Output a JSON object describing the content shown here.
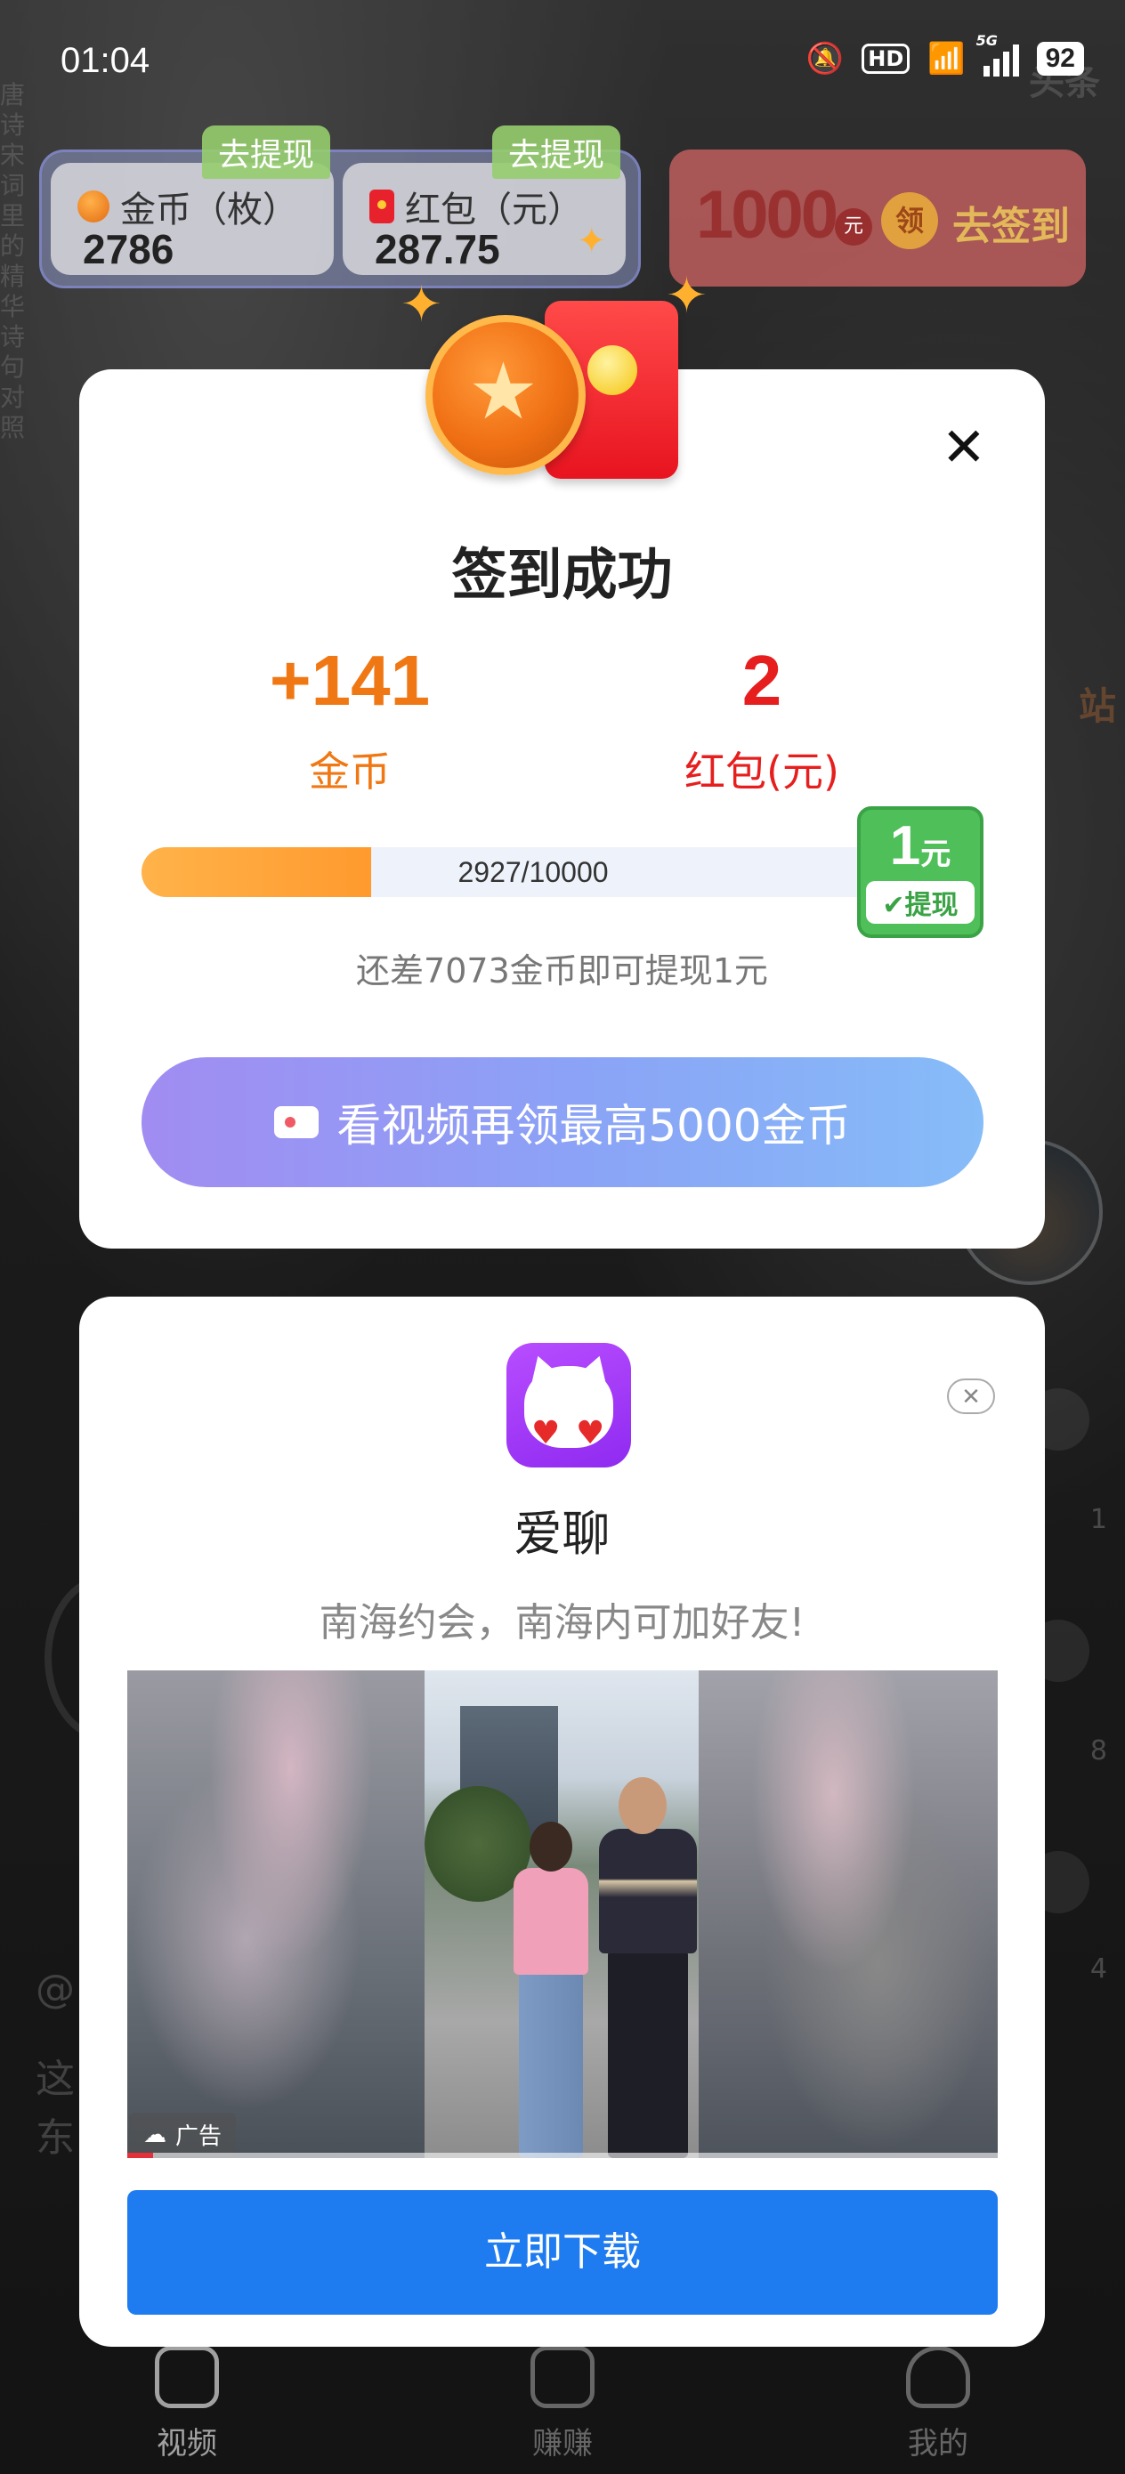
{
  "status_bar": {
    "time": "01:04",
    "hd": "HD",
    "network": "5G",
    "battery": "92"
  },
  "rewards_header": {
    "coins": {
      "label": "金币（枚）",
      "value": "2786",
      "tag": "去提现"
    },
    "red_packet": {
      "label": "红包（元）",
      "value": "287.75",
      "tag": "去提现"
    },
    "signin_banner": {
      "amount": "1000",
      "unit": "元",
      "ling": "领",
      "cta": "去签到"
    }
  },
  "background": {
    "right_top_text": "头条",
    "right_station_text": "站",
    "counts": [
      "1",
      "8",
      "4"
    ],
    "left_text_1": "@",
    "left_text_2": "这",
    "left_text_3": "东"
  },
  "signin_dialog": {
    "title": "签到成功",
    "coin_reward": {
      "value": "+141",
      "unit": "金币"
    },
    "red_reward": {
      "value": "2",
      "unit": "红包(元)"
    },
    "progress": {
      "current": 2927,
      "total": 10000,
      "text": "2927/10000"
    },
    "withdraw_badge": {
      "amount": "1",
      "unit": "元",
      "action": "提现"
    },
    "hint": "还差7073金币即可提现1元",
    "watch_button": "看视频再领最高5000金币"
  },
  "ad_card": {
    "app_name": "爱聊",
    "description": "南海约会，南海内可加好友!",
    "ad_label": "广告",
    "video_progress": 0.03,
    "download_button": "立即下载"
  },
  "bottom_nav": {
    "items": [
      {
        "label": "视频",
        "icon": "video-icon"
      },
      {
        "label": "赚赚",
        "icon": "wallet-icon"
      },
      {
        "label": "我的",
        "icon": "profile-icon"
      }
    ]
  },
  "colors": {
    "coin_orange": "#f07814",
    "red": "#e61e1e",
    "withdraw_green": "#4fbf59",
    "download_blue": "#1f7cf0"
  }
}
